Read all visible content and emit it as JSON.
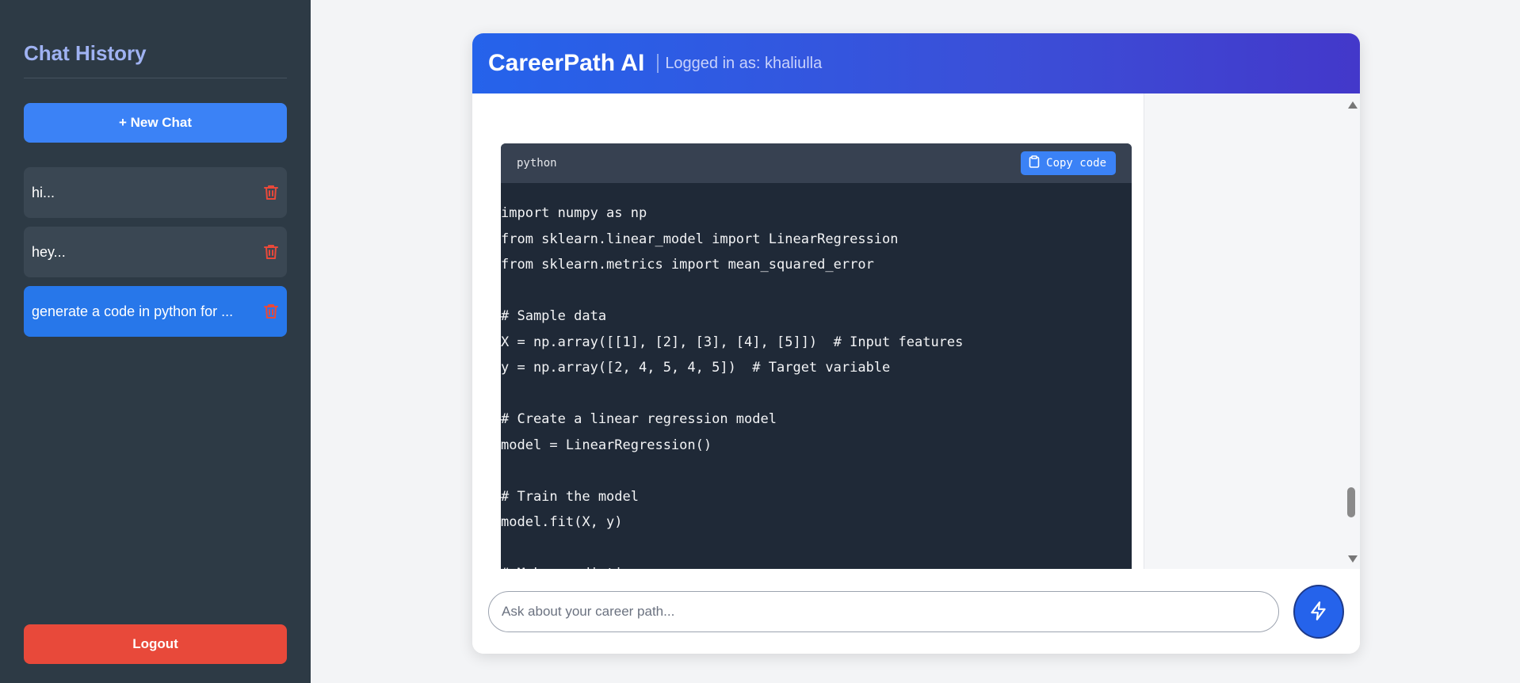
{
  "sidebar": {
    "title": "Chat History",
    "new_chat_label": "+ New Chat",
    "items": [
      {
        "label": "hi..."
      },
      {
        "label": "hey..."
      },
      {
        "label": "generate a code in python for ..."
      }
    ],
    "logout_label": "Logout"
  },
  "header": {
    "title": "CareerPath AI",
    "login_status": "Logged in as: khaliulla"
  },
  "code_block": {
    "language": "python",
    "copy_label": "Copy code",
    "lines": [
      "import numpy as np",
      "from sklearn.linear_model import LinearRegression",
      "from sklearn.metrics import mean_squared_error",
      "",
      "# Sample data",
      "X = np.array([[1], [2], [3], [4], [5]])  # Input features",
      "y = np.array([2, 4, 5, 4, 5])  # Target variable",
      "",
      "# Create a linear regression model",
      "model = LinearRegression()",
      "",
      "# Train the model",
      "model.fit(X, y)",
      "",
      "# Make predictions"
    ]
  },
  "input": {
    "placeholder": "Ask about your career path...",
    "value": ""
  },
  "icons": {
    "trash": "trash-icon",
    "clipboard": "clipboard-icon",
    "send": "lightning-bolt-icon"
  },
  "colors": {
    "sidebar_bg": "#2d3a45",
    "accent": "#3b82f6",
    "active_item": "#2777ea",
    "logout": "#e8493a",
    "trash": "#e8493a",
    "code_bg": "#1f2937"
  }
}
